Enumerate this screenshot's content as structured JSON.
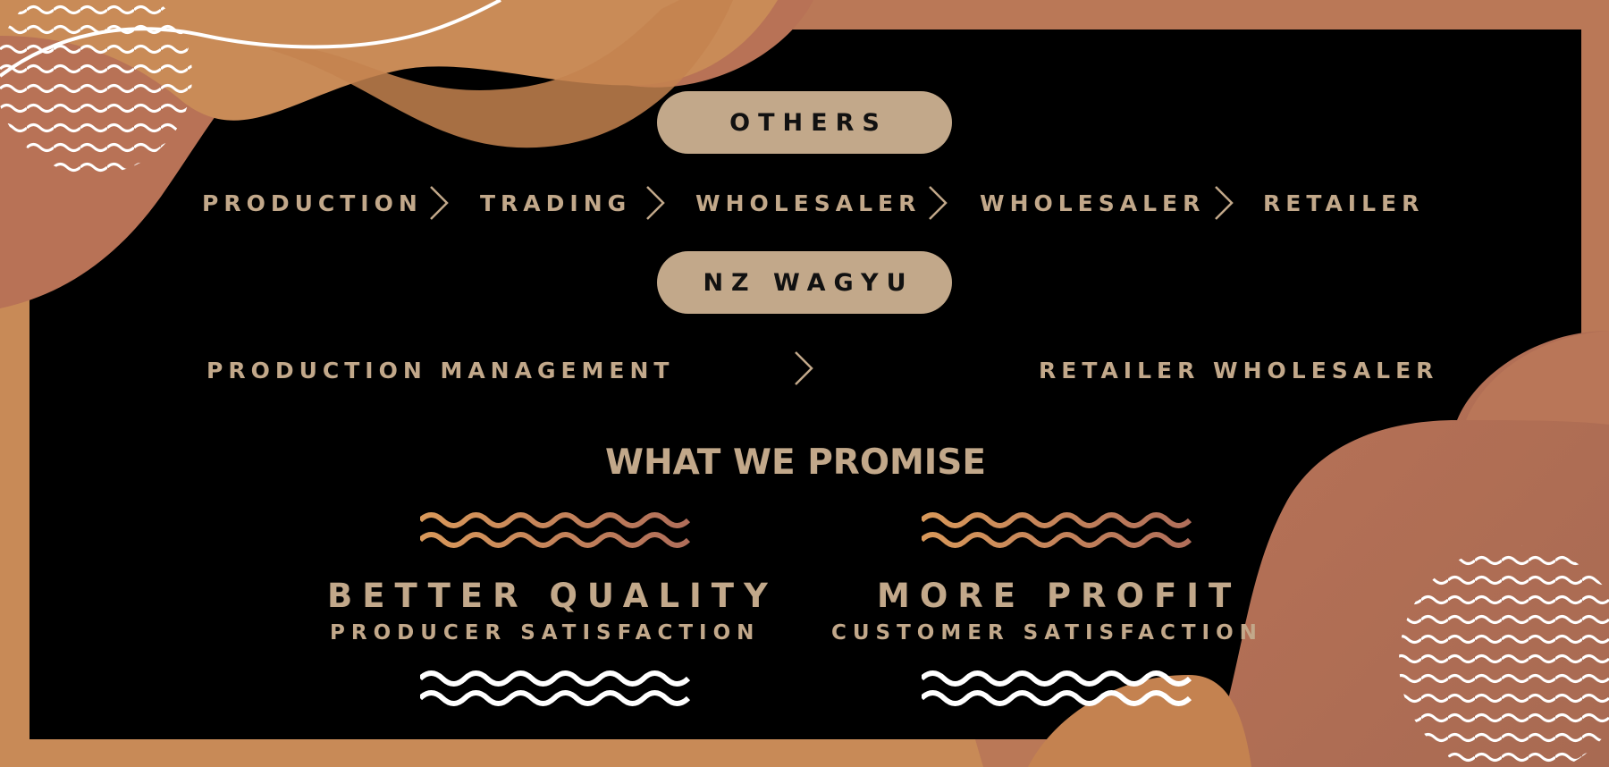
{
  "colors": {
    "background": "#000000",
    "accent": "#c2a88a",
    "copper_light": "#d4945a",
    "copper_dark": "#b37258",
    "white": "#ffffff"
  },
  "others": {
    "label": "OTHERS",
    "steps": [
      "PRODUCTION",
      "TRADING",
      "WHOLESALER",
      "WHOLESALER",
      "RETAILER"
    ]
  },
  "nz_wagyu": {
    "label": "NZ WAGYU",
    "steps": [
      "PRODUCTION MANAGEMENT",
      "RETAILER WHOLESALER"
    ]
  },
  "promise": {
    "title": "WHAT WE PROMISE",
    "items": [
      {
        "title": "BETTER QUALITY",
        "subtitle": "PRODUCER SATISFACTION"
      },
      {
        "title": "MORE PROFIT",
        "subtitle": "CUSTOMER SATISFACTION"
      }
    ]
  },
  "icons": [
    "chevron-right-icon",
    "wave-lines-icon"
  ]
}
